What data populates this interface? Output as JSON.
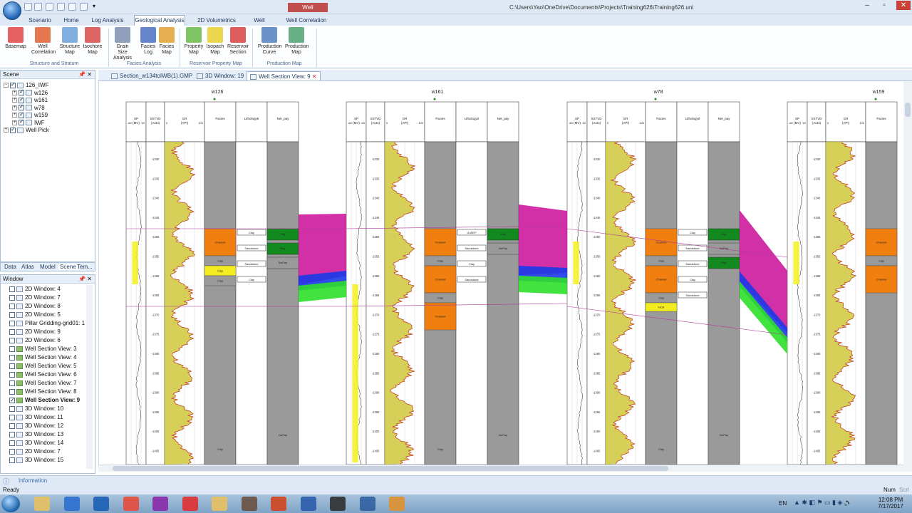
{
  "window": {
    "title": "Well Correlation",
    "file_path": "C:\\Users\\Yao\\OneDrive\\Documents\\Projects\\Training626\\Training626.uni"
  },
  "menu_tabs": [
    "Scenario",
    "Home",
    "Log Analysis",
    "Geological Analysis",
    "2D Volumetrics",
    "Well Plan",
    "Well Correlation"
  ],
  "ribbon": {
    "buttons": [
      {
        "label1": "Basemap",
        "label2": "",
        "icon": "basemap-icon",
        "color": "#e04545"
      },
      {
        "label1": "Well",
        "label2": "Correlation",
        "icon": "well-correlation-icon",
        "color": "#e06030"
      },
      {
        "label1": "Structure",
        "label2": "Map",
        "icon": "structure-map-icon",
        "color": "#6aa0d8"
      },
      {
        "label1": "Isochore",
        "label2": "Map",
        "icon": "isochore-map-icon",
        "color": "#d84a4a"
      },
      {
        "label1": "Grain Size",
        "label2": "Analysis",
        "icon": "grain-size-icon",
        "color": "#7c8fb0"
      },
      {
        "label1": "Facies",
        "label2": "Log",
        "icon": "facies-log-icon",
        "color": "#4a6ec0"
      },
      {
        "label1": "Facies",
        "label2": "Map",
        "icon": "facies-map-icon",
        "color": "#e0a030"
      },
      {
        "label1": "Property",
        "label2": "Map",
        "icon": "property-map-icon",
        "color": "#68b848"
      },
      {
        "label1": "Isopach",
        "label2": "Map",
        "icon": "isopach-map-icon",
        "color": "#e8d030"
      },
      {
        "label1": "Reservoir",
        "label2": "Section",
        "icon": "reservoir-section-icon",
        "color": "#d84040"
      },
      {
        "label1": "Production",
        "label2": "Curve",
        "icon": "production-curve-icon",
        "color": "#5080c0"
      },
      {
        "label1": "Production",
        "label2": "Map",
        "icon": "production-map-icon",
        "color": "#50a070"
      }
    ],
    "groups": [
      "Structure and Stratum",
      "Facies Analysis",
      "Reservoir Property Map",
      "Production Map"
    ]
  },
  "scene": {
    "title": "Scene",
    "items": [
      {
        "label": "126_IWF",
        "level": 0,
        "exp": "−"
      },
      {
        "label": "w126",
        "level": 1,
        "exp": "+"
      },
      {
        "label": "w161",
        "level": 1,
        "exp": "+"
      },
      {
        "label": "w78",
        "level": 1,
        "exp": "+"
      },
      {
        "label": "w159",
        "level": 1,
        "exp": "+"
      },
      {
        "label": "IWF",
        "level": 1,
        "exp": "+"
      },
      {
        "label": "Well Pick",
        "level": 0,
        "exp": "+"
      }
    ]
  },
  "panel_tabs": [
    "Data",
    "Atlas",
    "Model",
    "Scene",
    "Tem..."
  ],
  "window_list": {
    "title": "Window",
    "items": [
      {
        "label": "2D Window: 4",
        "checked": false,
        "kind": "2D"
      },
      {
        "label": "2D Window: 7",
        "checked": false,
        "kind": "2D"
      },
      {
        "label": "2D Window: 8",
        "checked": false,
        "kind": "2D"
      },
      {
        "label": "2D Window: 5",
        "checked": false,
        "kind": "2D"
      },
      {
        "label": "Pillar Gridding-grid01: 1",
        "checked": false,
        "kind": "grid"
      },
      {
        "label": "2D Window: 9",
        "checked": false,
        "kind": "2D"
      },
      {
        "label": "2D Window: 6",
        "checked": false,
        "kind": "2D"
      },
      {
        "label": "Well Section View: 3",
        "checked": false,
        "kind": "ws"
      },
      {
        "label": "Well Section View: 4",
        "checked": false,
        "kind": "ws"
      },
      {
        "label": "Well Section View: 5",
        "checked": false,
        "kind": "ws"
      },
      {
        "label": "Well Section View: 6",
        "checked": false,
        "kind": "ws"
      },
      {
        "label": "Well Section View: 7",
        "checked": false,
        "kind": "ws"
      },
      {
        "label": "Well Section View: 8",
        "checked": false,
        "kind": "ws"
      },
      {
        "label": "Well Section View: 9",
        "checked": true,
        "kind": "ws",
        "bold": true
      },
      {
        "label": "3D Window: 10",
        "checked": false,
        "kind": "3D"
      },
      {
        "label": "3D Window: 11",
        "checked": false,
        "kind": "3D"
      },
      {
        "label": "3D Window: 12",
        "checked": false,
        "kind": "3D"
      },
      {
        "label": "3D Window: 13",
        "checked": false,
        "kind": "3D"
      },
      {
        "label": "3D Window: 14",
        "checked": false,
        "kind": "3D"
      },
      {
        "label": "2D Window: 7",
        "checked": false,
        "kind": "2D"
      },
      {
        "label": "3D Window: 15",
        "checked": false,
        "kind": "3D"
      }
    ]
  },
  "doc_tabs": [
    {
      "label": "Section_w134toIWB(1).GMP",
      "active": false
    },
    {
      "label": "3D Window: 19",
      "active": false
    },
    {
      "label": "Well Section View: 9",
      "active": true
    }
  ],
  "section": {
    "wells": [
      {
        "name": "w126",
        "facies": [
          {
            "label": "Channel",
            "color": "#f07f10"
          },
          {
            "label": "Clay",
            "color": "#9a9a9a"
          },
          {
            "label": "Clay",
            "color": "#f2ec20"
          },
          {
            "label": "Clay",
            "color": "#9a9a9a"
          }
        ],
        "lith": [
          "Clay",
          "Sandstone",
          "Sandstone",
          "Clay"
        ],
        "netpay": [
          "Pay",
          "Pay",
          "NoPay"
        ],
        "bottom": [
          "Clay",
          "NoPay"
        ]
      },
      {
        "name": "w161",
        "facies": [
          {
            "label": "Channel",
            "color": "#f07f10"
          },
          {
            "label": "Clay",
            "color": "#9a9a9a"
          },
          {
            "label": "Channel",
            "color": "#f07f10"
          },
          {
            "label": "Clay",
            "color": "#9a9a9a"
          },
          {
            "label": "Channel",
            "color": "#f07f10"
          }
        ],
        "lith": [
          "UnSEP",
          "Sandstone",
          "Clay",
          "Sandstone"
        ],
        "netpay": [
          "Pay",
          "NoPay"
        ],
        "bottom": [
          "Clay",
          "NoPay"
        ]
      },
      {
        "name": "w78",
        "facies": [
          {
            "label": "Channel",
            "color": "#f07f10"
          },
          {
            "label": "Clay",
            "color": "#9a9a9a"
          },
          {
            "label": "Channel",
            "color": "#f07f10"
          },
          {
            "label": "Clay",
            "color": "#9a9a9a"
          },
          {
            "label": "HCB",
            "color": "#f2ec20"
          }
        ],
        "lith": [
          "Clay",
          "Sandstone",
          "Sandstone",
          "Clay",
          "Sandstone"
        ],
        "netpay": [
          "Pay",
          "NoPay",
          "Pay"
        ],
        "bottom": [
          "Clay",
          "NoPay"
        ]
      },
      {
        "name": "w159",
        "facies": [
          {
            "label": "Channel",
            "color": "#f07f10"
          },
          {
            "label": "Clay",
            "color": "#9a9a9a"
          },
          {
            "label": "Channel",
            "color": "#f07f10"
          }
        ],
        "lith": [],
        "netpay": [],
        "bottom": []
      }
    ],
    "headers": {
      "sp": "SP",
      "sp_unit": "(MV)",
      "sp_min": "-60",
      "sp_max": "60",
      "sstvd": "SSTVD",
      "sstvd_unit": "(Auto)",
      "gr": "GR",
      "gr_unit": "(API)",
      "gr_min": "0",
      "gr_max": "100",
      "facies": "Facies",
      "lith": "Lithology0",
      "netpay": "Net_pay"
    },
    "depths": [
      "-1330",
      "-1335",
      "-1340",
      "-1345",
      "-1350",
      "-1355",
      "-1360",
      "-1365",
      "-1370",
      "-1375",
      "-1380",
      "-1385",
      "-1390",
      "-1395",
      "-1400",
      "-1405"
    ]
  },
  "info_label": "Information",
  "status": {
    "ready": "Ready",
    "num": "Num",
    "scrl": "Scrl"
  },
  "tray": {
    "lang": "EN",
    "time": "12:08 PM",
    "date": "7/17/2017"
  },
  "taskbar_apps": [
    {
      "icon": "folder-icon",
      "color": "#e8c060"
    },
    {
      "icon": "bookmark-app-icon",
      "color": "#2a6fd0"
    },
    {
      "icon": "outlook-icon",
      "color": "#1a5fb4"
    },
    {
      "icon": "chrome-icon",
      "color": "#e84a3a"
    },
    {
      "icon": "onenote-icon",
      "color": "#8a2aa8"
    },
    {
      "icon": "8x8-icon",
      "color": "#e03030"
    },
    {
      "icon": "file-explorer-icon",
      "color": "#e8c060"
    },
    {
      "icon": "user-photo-icon",
      "color": "#6a5040"
    },
    {
      "icon": "powerpoint-icon",
      "color": "#d04520"
    },
    {
      "icon": "word-icon",
      "color": "#2a5caa"
    },
    {
      "icon": "obs-icon",
      "color": "#303030"
    },
    {
      "icon": "app-icon",
      "color": "#3060a0"
    },
    {
      "icon": "video-icon",
      "color": "#e09030"
    }
  ]
}
